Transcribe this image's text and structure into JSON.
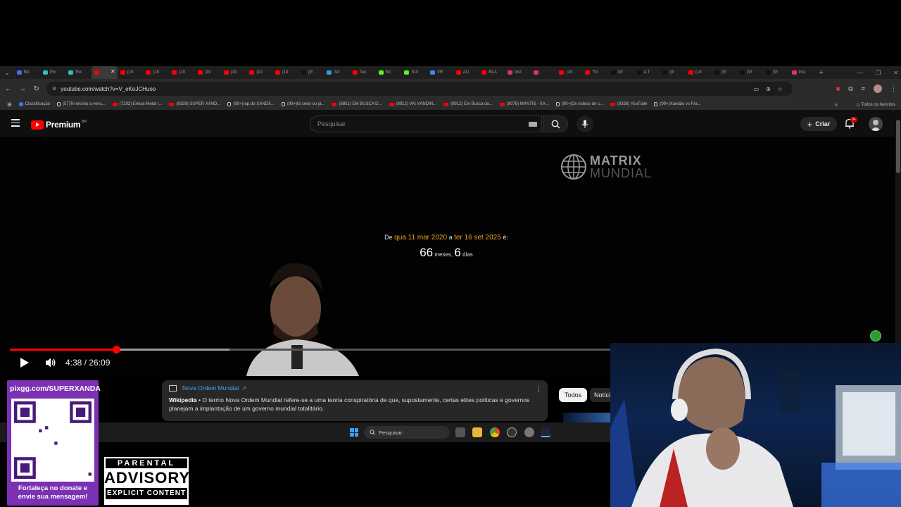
{
  "browser": {
    "tabs": [
      {
        "label": "Bit:",
        "color": "#4a6cf7"
      },
      {
        "label": "Pix:",
        "color": "#2ec4b6"
      },
      {
        "label": "Pix:",
        "color": "#2ec4b6"
      },
      {
        "label": "",
        "color": "#ff0000",
        "active": true
      },
      {
        "label": "(19",
        "color": "#ff0000"
      },
      {
        "label": "(19",
        "color": "#ff0000"
      },
      {
        "label": "(19",
        "color": "#ff0000"
      },
      {
        "label": "(19",
        "color": "#ff0000"
      },
      {
        "label": "(19",
        "color": "#ff0000"
      },
      {
        "label": "(19",
        "color": "#ff0000"
      },
      {
        "label": "(19",
        "color": "#ff0000"
      },
      {
        "label": "(9!",
        "color": "#111111"
      },
      {
        "label": "Tel:",
        "color": "#2aa3e0"
      },
      {
        "label": "Tex",
        "color": "#ff0000"
      },
      {
        "label": "Str",
        "color": "#53fc18"
      },
      {
        "label": "SU!",
        "color": "#53fc18"
      },
      {
        "label": "VR",
        "color": "#4285f4"
      },
      {
        "label": "ALI",
        "color": "#ff0000"
      },
      {
        "label": "BLA",
        "color": "#ff0000"
      },
      {
        "label": "Inst",
        "color": "#e1306c"
      },
      {
        "label": "",
        "color": "#e1306c"
      },
      {
        "label": "(19",
        "color": "#ff0000"
      },
      {
        "label": "\"NI",
        "color": "#ff0000"
      },
      {
        "label": "(9!",
        "color": "#111111"
      },
      {
        "label": "A T",
        "color": "#111111"
      },
      {
        "label": "(9!",
        "color": "#111111"
      },
      {
        "label": "(19",
        "color": "#ff0000"
      },
      {
        "label": "(9!",
        "color": "#111111"
      },
      {
        "label": "(9!",
        "color": "#111111"
      },
      {
        "label": "(9!",
        "color": "#111111"
      },
      {
        "label": "Inst",
        "color": "#e1306c"
      }
    ],
    "close_glyph": "✕",
    "newtab_glyph": "+",
    "url": "youtube.com/watch?v=V_eKoJCHuoo",
    "bookmarks": [
      {
        "label": "Classificação",
        "kind": "gl"
      },
      {
        "label": "(57)Te ensino a venc...",
        "kind": "tt"
      },
      {
        "label": "(7292) Enéas Metal |...",
        "kind": "yt"
      },
      {
        "label": "(8159) SUPER XAND...",
        "kind": "yt"
      },
      {
        "label": "(99+)rap do XANDÃ...",
        "kind": "tt"
      },
      {
        "label": "(99+)tá cedo ou já...",
        "kind": "tt"
      },
      {
        "label": "(8851) EM BUSCA D...",
        "kind": "yt"
      },
      {
        "label": "(8912) VAI XANDIN...",
        "kind": "yt"
      },
      {
        "label": "(8912) Em Busca da...",
        "kind": "yt"
      },
      {
        "label": "(9078) MANTIS - XA...",
        "kind": "yt"
      },
      {
        "label": "(99+)Os vídeos de c...",
        "kind": "tt"
      },
      {
        "label": "(9338) YouTube",
        "kind": "yt"
      },
      {
        "label": "(99+)Xandão vs Fra...",
        "kind": "tt"
      }
    ],
    "bookmarks_more": "»",
    "all_bookmarks": "Todos os favoritos"
  },
  "youtube": {
    "logo_text": "Premium",
    "logo_country": "BR",
    "search_placeholder": "Pesquisar",
    "create_label": "Criar",
    "notif_badge": "9+"
  },
  "video": {
    "channel_logo_1": "MATRIX",
    "channel_logo_2": "MUNDIAL",
    "date_prefix": "De",
    "date_start": "qua 11 mar 2020",
    "date_mid": "a",
    "date_end": "ter 16 set 2025",
    "date_suffix": "é:",
    "months_value": "66",
    "months_unit": "meses,",
    "days_value": "6",
    "days_unit": "dias",
    "progress_played": 0.1768,
    "time_display": "4:38 / 26:09"
  },
  "info_panel": {
    "title": "Nova Ordem Mundial",
    "source": "Wikipedia",
    "separator": " • ",
    "text": "O termo Nova Ordem Mundial refere-se a uma teoria conspiratória de que, supostamente, certas elites políticas e governos planejam a implantação de um governo mundial totalitário."
  },
  "chips": [
    "Todos",
    "Notíci"
  ],
  "taskbar": {
    "search_placeholder": "Pesquisar"
  },
  "overlay": {
    "donate_url": "pixgg.com/SUPERXANDA",
    "donate_line1": "Fortaleça no donate e",
    "donate_line2": "envie sua mensagem!",
    "advisory_top": "PARENTAL",
    "advisory_mid": "ADVISORY",
    "advisory_bot": "EXPLICIT CONTENT"
  },
  "colors": {
    "youtube_red": "#ff0000",
    "date_highlight": "#f0a020",
    "donate_bg": "#7b31b3",
    "link_blue": "#3ea6ff"
  }
}
